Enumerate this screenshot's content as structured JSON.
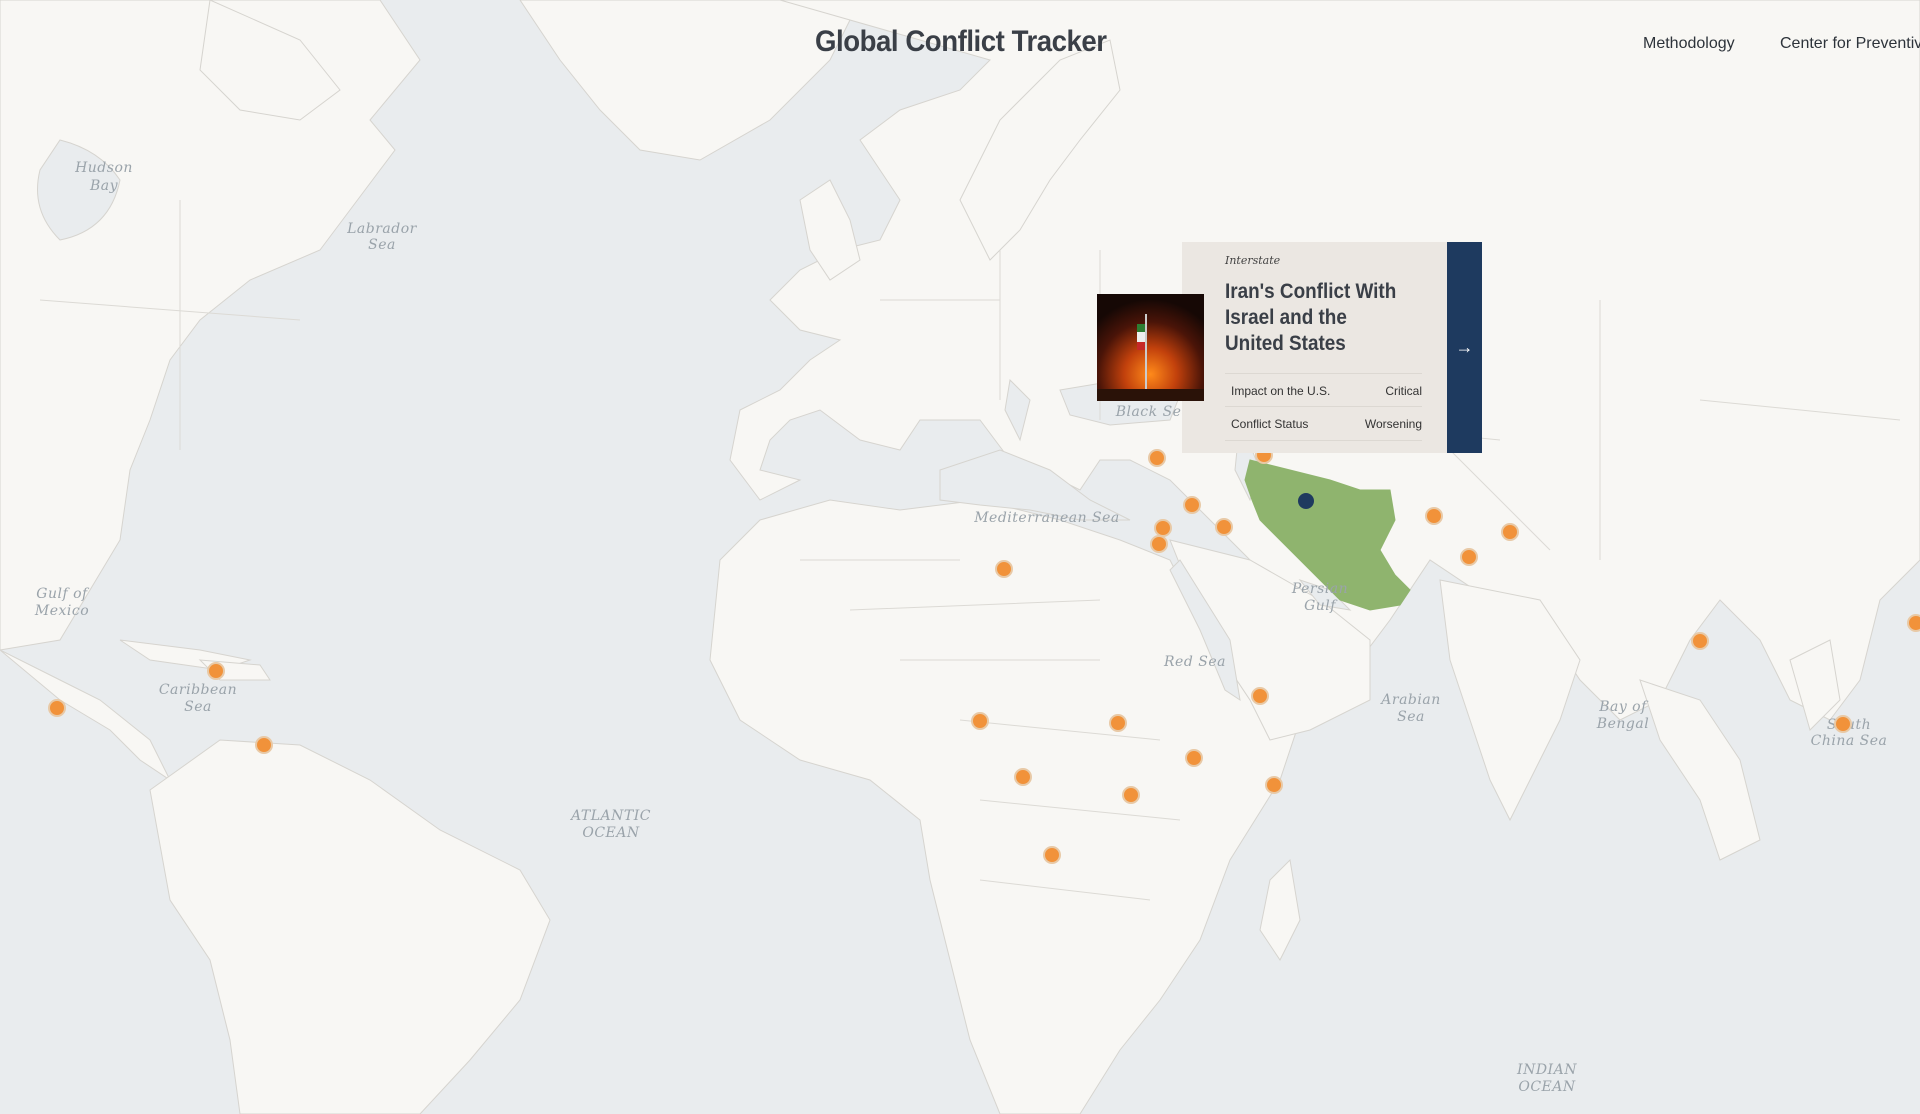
{
  "header": {
    "title": "Global Conflict Tracker"
  },
  "nav": {
    "items": [
      "Methodology",
      "Center for Preventiv"
    ]
  },
  "water_labels": [
    "Hudson",
    "Bay",
    "Labrador",
    "Sea",
    "Gulf of",
    "Mexico",
    "Caribbean",
    "Sea",
    "ATLANTIC",
    "OCEAN",
    "Mediterranean Sea",
    "Black Sea",
    "Red Sea",
    "Persian",
    "Gulf",
    "Arabian",
    "Sea",
    "Bay of",
    "Bengal",
    "South",
    "China Sea",
    "INDIAN",
    "OCEAN"
  ],
  "popup": {
    "category": "Interstate",
    "title": "Iran's Conflict With Israel and the United States",
    "rows": [
      {
        "label": "Impact on the U.S.",
        "value": "Critical"
      },
      {
        "label": "Conflict Status",
        "value": "Worsening"
      }
    ],
    "arrow_icon": "arrow-right-icon"
  },
  "colors": {
    "marker": "#f1923a",
    "selected_marker": "#1f3a5f",
    "highlight_country": "#8fb46e",
    "popup_bg": "#ebe7e2",
    "arrow_bg": "#1e3a5f"
  },
  "markers_count_visible": 30
}
